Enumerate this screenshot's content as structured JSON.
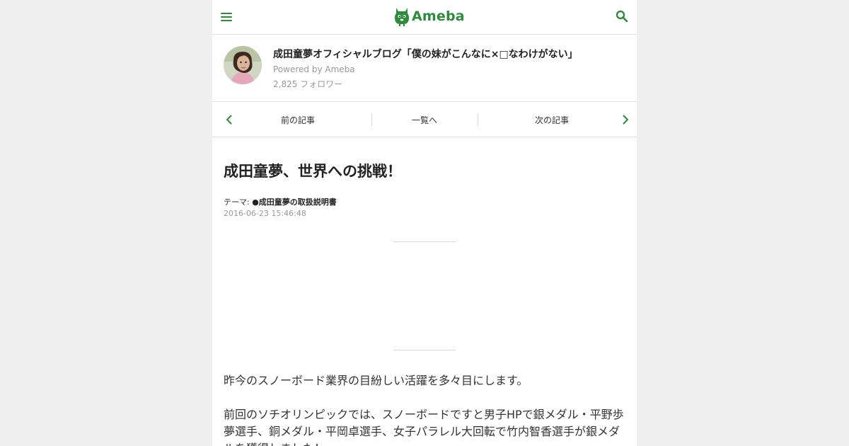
{
  "header": {
    "logo_text": "Ameba",
    "menu_icon": "hamburger-menu-icon",
    "search_icon": "search-icon",
    "accent_color": "#2d8c3c"
  },
  "blog": {
    "title": "成田童夢オフィシャルブログ「僕の妹がこんなに×□なわけがない」",
    "powered_by": "Powered by Ameba",
    "followers": "2,825 フォロワー"
  },
  "nav": {
    "prev_label": "前の記事",
    "list_label": "一覧へ",
    "next_label": "次の記事"
  },
  "article": {
    "title": "成田童夢、世界への挑戦！",
    "theme_prefix": "テーマ: ",
    "theme": "●成田童夢の取扱説明書",
    "date": "2016-06-23 15:46:48",
    "paragraphs": [
      "昨今のスノーボード業界の目紛しい活躍を多々目にします。",
      "前回のソチオリンピックでは、スノーボードですと男子HPで銀メダル・平野歩夢選手、銅メダル・平岡卓選手、女子パラレル大回転で竹内智香選手が銀メダルを獲得しました！"
    ]
  }
}
